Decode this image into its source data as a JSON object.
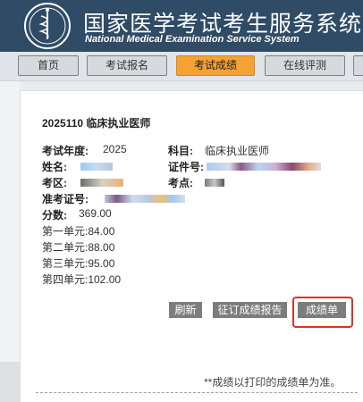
{
  "header": {
    "title_cn": "国家医学考试考生服务系统",
    "title_en": "National Medical Examination Service System"
  },
  "nav": {
    "items": [
      {
        "label": "首页"
      },
      {
        "label": "考试报名"
      },
      {
        "label": "考试成绩"
      },
      {
        "label": "在线评测"
      }
    ],
    "active": "考试成绩"
  },
  "exam": {
    "title": "2025110  临床执业医师",
    "year_label": "考试年度:",
    "year_value": "2025",
    "subject_label": "科目:",
    "subject_value": "临床执业医师",
    "name_label": "姓名:",
    "id_label": "证件号:",
    "area_label": "考区:",
    "site_label": "考点:",
    "ticket_label": "准考证号:",
    "score_label": "分数:",
    "score_value": "369.00",
    "units": [
      {
        "text": "第一单元:84.00"
      },
      {
        "text": "第二单元:88.00"
      },
      {
        "text": "第三单元:95.00"
      },
      {
        "text": "第四单元:102.00"
      }
    ]
  },
  "actions": {
    "refresh": "刷新",
    "order_report": "征订成绩报告",
    "score_sheet": "成绩单"
  },
  "note": "**成绩以打印的成绩单为准。",
  "colors": {
    "header_bg": "#2f4b66",
    "nav_active": "#f3a233",
    "action_btn": "#7d7d7d",
    "highlight": "#e0302a"
  }
}
